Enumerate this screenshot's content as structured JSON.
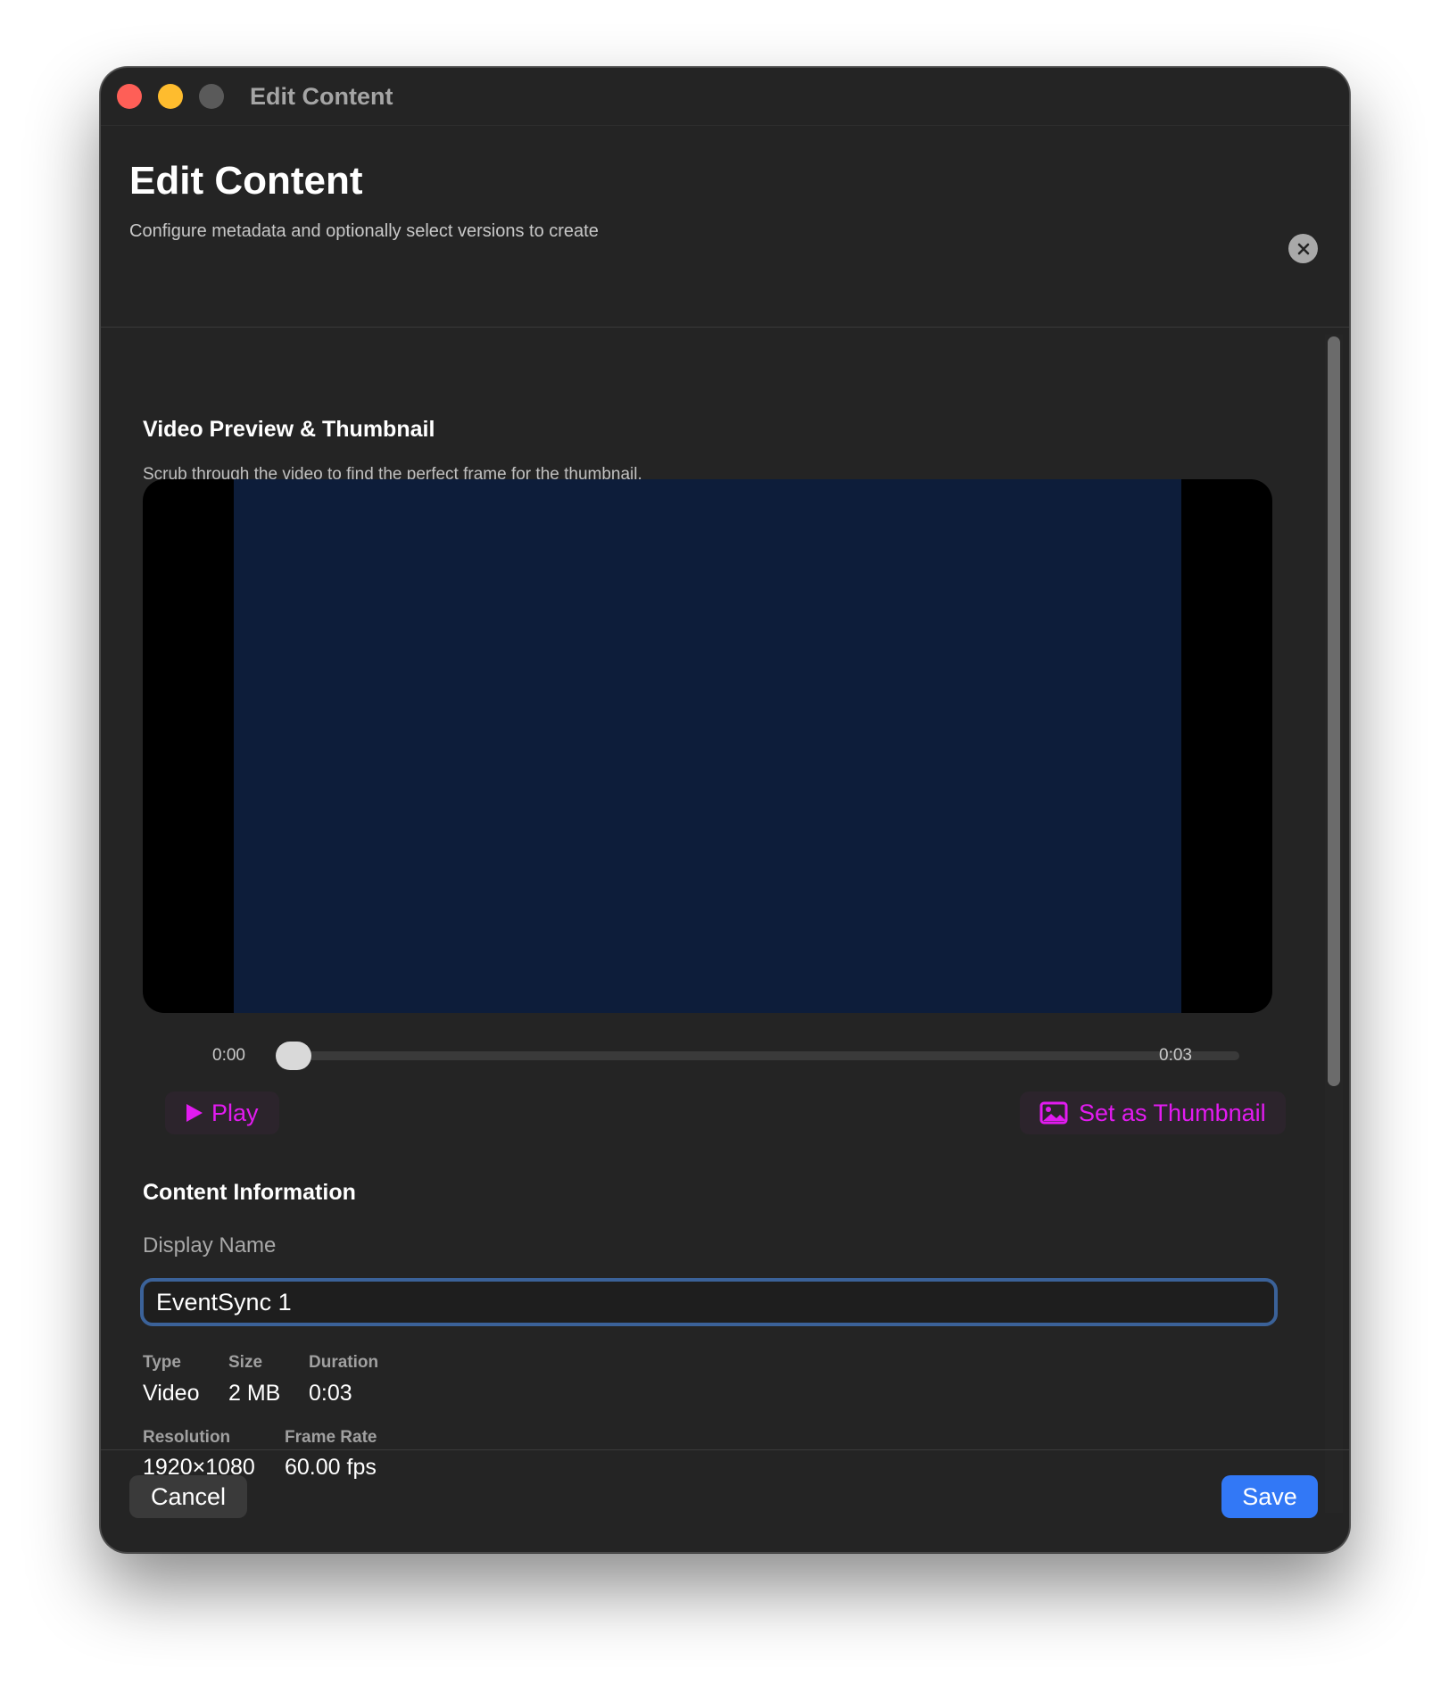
{
  "window": {
    "title": "Edit Content"
  },
  "header": {
    "title": "Edit Content",
    "subtitle": "Configure metadata and optionally select versions to create"
  },
  "preview": {
    "title": "Video Preview & Thumbnail",
    "description": "Scrub through the video to find the perfect frame for the thumbnail.",
    "current_time": "0:00",
    "total_time": "0:03",
    "scrub_position": 0.0,
    "play_label": "Play",
    "thumbnail_label": "Set as Thumbnail"
  },
  "info": {
    "title": "Content Information",
    "display_name_label": "Display Name",
    "display_name_value": "EventSync 1",
    "type_label": "Type",
    "type_value": "Video",
    "size_label": "Size",
    "size_value": "2 MB",
    "duration_label": "Duration",
    "duration_value": "0:03",
    "resolution_label": "Resolution",
    "resolution_value": "1920×1080",
    "framerate_label": "Frame Rate",
    "framerate_value": "60.00 fps"
  },
  "footer": {
    "cancel_label": "Cancel",
    "save_label": "Save"
  },
  "colors": {
    "accent": "#e21bf0",
    "primary_button": "#3278f6",
    "focus_ring": "#3b6299",
    "video_frame": "#0d1d3a"
  },
  "icons": {
    "close": "close-icon",
    "play": "play-icon",
    "thumbnail": "photo-icon"
  }
}
